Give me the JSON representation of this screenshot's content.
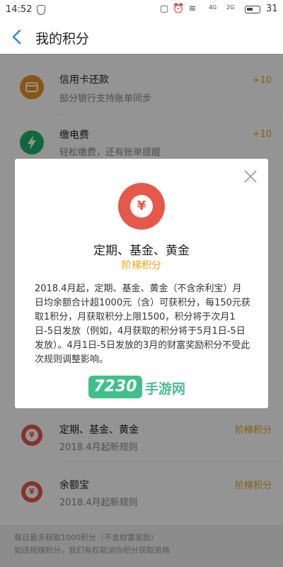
{
  "status_bar": {
    "time": "14:52",
    "net_a": "4G",
    "net_b": "2G",
    "battery": "31"
  },
  "nav": {
    "title": "我的积分"
  },
  "list": [
    {
      "title": "信用卡还款",
      "subtitle": "部分银行支持账单同步",
      "points": "+10",
      "icon": "credit-card-icon",
      "color": "#e8941f"
    },
    {
      "title": "缴电费",
      "subtitle": "轻松缴费，还有账单提醒",
      "points": "+10",
      "icon": "lightning-icon",
      "color": "#1fb36b"
    },
    {
      "title": "定期、基金、黄金",
      "subtitle": "2018.4月起新规则",
      "points": "阶梯积分",
      "icon": "yuan-icon",
      "color": "#e6584a"
    },
    {
      "title": "余额宝",
      "subtitle": "2018.4月起新规则",
      "points": "阶梯积分",
      "icon": "yuan-icon",
      "color": "#e6584a"
    }
  ],
  "footer": {
    "line1": "每日最多获取1000积分（不含财富奖励）",
    "line2": "如违规赚积分，我们有权取消你积分获取资格"
  },
  "modal": {
    "icon_glyph": "¥",
    "title": "定期、基金、黄金",
    "subtitle": "阶梯积分",
    "body": "2018.4月起，定期、基金、黄金（不含余利宝）月日均余额合计超1000元（含）可获积分，每150元获取1积分，月获取积分上限1500，积分将于次月1日-5日发放（例如，4月获取的积分将于5月1日-5日发放）。4月1日-5日发放的3月的财富奖励积分不受此次规则调整影响。"
  },
  "watermark": {
    "number": "7230",
    "text": "手游网"
  },
  "colors": {
    "accent_orange": "#e8a21b",
    "nav_blue": "#2a8ee0",
    "badge_red": "#e6584a"
  }
}
